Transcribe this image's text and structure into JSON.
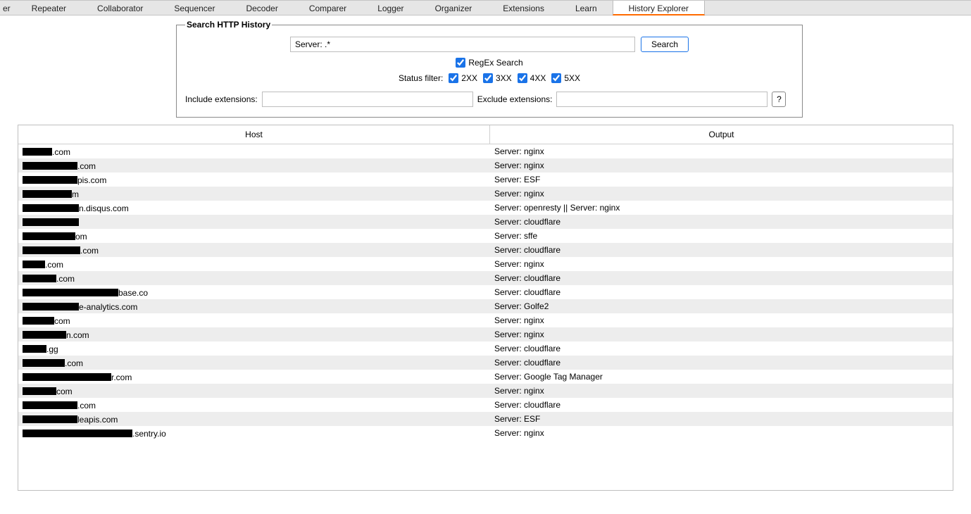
{
  "tabs": {
    "partial": "er",
    "items": [
      "Repeater",
      "Collaborator",
      "Sequencer",
      "Decoder",
      "Comparer",
      "Logger",
      "Organizer",
      "Extensions",
      "Learn",
      "History Explorer"
    ],
    "active": "History Explorer"
  },
  "search": {
    "legend": "Search HTTP History",
    "input_value": "Server: .*",
    "button": "Search",
    "regex_label": "RegEx Search",
    "regex_checked": true,
    "status_label": "Status filter:",
    "status": [
      {
        "label": "2XX",
        "checked": true
      },
      {
        "label": "3XX",
        "checked": true
      },
      {
        "label": "4XX",
        "checked": true
      },
      {
        "label": "5XX",
        "checked": true
      }
    ],
    "include_label": "Include extensions:",
    "include_value": "",
    "exclude_label": "Exclude extensions:",
    "exclude_value": "",
    "help_label": "?"
  },
  "table": {
    "headers": {
      "host": "Host",
      "output": "Output"
    },
    "rows": [
      {
        "redact_w": 42,
        "suffix": ".com",
        "output": "Server: nginx"
      },
      {
        "redact_w": 78,
        "suffix": ".com",
        "output": "Server: nginx"
      },
      {
        "redact_w": 78,
        "suffix": "pis.com",
        "output": "Server: ESF"
      },
      {
        "redact_w": 70,
        "suffix": "m",
        "output": "Server: nginx"
      },
      {
        "redact_w": 80,
        "suffix": "n.disqus.com",
        "output": "Server: openresty || Server: nginx"
      },
      {
        "redact_w": 80,
        "suffix": "",
        "output": "Server: cloudflare"
      },
      {
        "redact_w": 75,
        "suffix": "om",
        "output": "Server: sffe"
      },
      {
        "redact_w": 82,
        "suffix": ".com",
        "output": "Server: cloudflare"
      },
      {
        "redact_w": 32,
        "suffix": ".com",
        "output": "Server: nginx"
      },
      {
        "redact_w": 48,
        "suffix": ".com",
        "output": "Server: cloudflare"
      },
      {
        "redact_w": 136,
        "suffix": "base.co",
        "output": "Server: cloudflare"
      },
      {
        "redact_w": 80,
        "suffix": "e-analytics.com",
        "output": "Server: Golfe2"
      },
      {
        "redact_w": 45,
        "suffix": "com",
        "output": "Server: nginx"
      },
      {
        "redact_w": 62,
        "suffix": "n.com",
        "output": "Server: nginx"
      },
      {
        "redact_w": 34,
        "suffix": ".gg",
        "output": "Server: cloudflare"
      },
      {
        "redact_w": 60,
        "suffix": ".com",
        "output": "Server: cloudflare"
      },
      {
        "redact_w": 126,
        "suffix": "r.com",
        "output": "Server: Google Tag Manager"
      },
      {
        "redact_w": 48,
        "suffix": "com",
        "output": "Server: nginx"
      },
      {
        "redact_w": 78,
        "suffix": ".com",
        "output": "Server: cloudflare"
      },
      {
        "redact_w": 78,
        "suffix": "leapis.com",
        "output": "Server: ESF"
      },
      {
        "redact_w": 156,
        "suffix": ".sentry.io",
        "output": "Server: nginx"
      }
    ]
  }
}
